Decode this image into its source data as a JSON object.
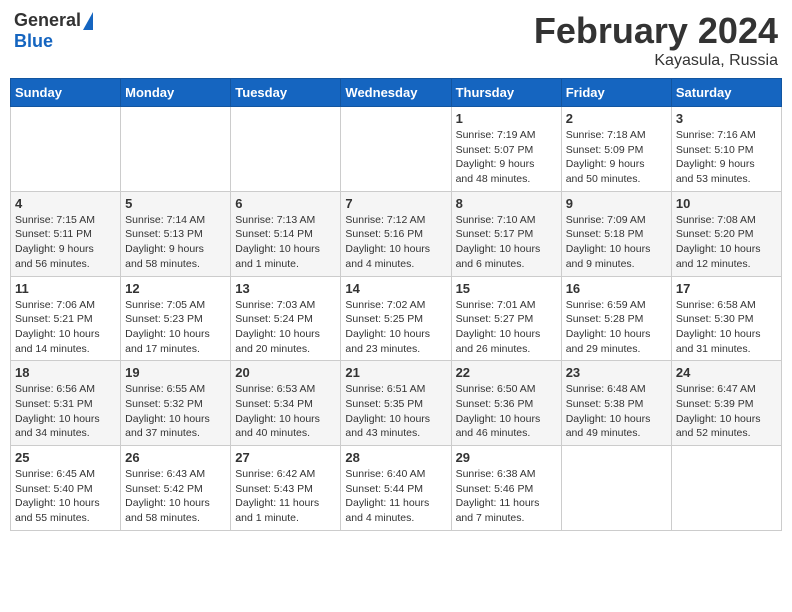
{
  "header": {
    "logo_general": "General",
    "logo_blue": "Blue",
    "month_title": "February 2024",
    "location": "Kayasula, Russia"
  },
  "days_of_week": [
    "Sunday",
    "Monday",
    "Tuesday",
    "Wednesday",
    "Thursday",
    "Friday",
    "Saturday"
  ],
  "weeks": [
    [
      {
        "day": "",
        "info": ""
      },
      {
        "day": "",
        "info": ""
      },
      {
        "day": "",
        "info": ""
      },
      {
        "day": "",
        "info": ""
      },
      {
        "day": "1",
        "info": "Sunrise: 7:19 AM\nSunset: 5:07 PM\nDaylight: 9 hours\nand 48 minutes."
      },
      {
        "day": "2",
        "info": "Sunrise: 7:18 AM\nSunset: 5:09 PM\nDaylight: 9 hours\nand 50 minutes."
      },
      {
        "day": "3",
        "info": "Sunrise: 7:16 AM\nSunset: 5:10 PM\nDaylight: 9 hours\nand 53 minutes."
      }
    ],
    [
      {
        "day": "4",
        "info": "Sunrise: 7:15 AM\nSunset: 5:11 PM\nDaylight: 9 hours\nand 56 minutes."
      },
      {
        "day": "5",
        "info": "Sunrise: 7:14 AM\nSunset: 5:13 PM\nDaylight: 9 hours\nand 58 minutes."
      },
      {
        "day": "6",
        "info": "Sunrise: 7:13 AM\nSunset: 5:14 PM\nDaylight: 10 hours\nand 1 minute."
      },
      {
        "day": "7",
        "info": "Sunrise: 7:12 AM\nSunset: 5:16 PM\nDaylight: 10 hours\nand 4 minutes."
      },
      {
        "day": "8",
        "info": "Sunrise: 7:10 AM\nSunset: 5:17 PM\nDaylight: 10 hours\nand 6 minutes."
      },
      {
        "day": "9",
        "info": "Sunrise: 7:09 AM\nSunset: 5:18 PM\nDaylight: 10 hours\nand 9 minutes."
      },
      {
        "day": "10",
        "info": "Sunrise: 7:08 AM\nSunset: 5:20 PM\nDaylight: 10 hours\nand 12 minutes."
      }
    ],
    [
      {
        "day": "11",
        "info": "Sunrise: 7:06 AM\nSunset: 5:21 PM\nDaylight: 10 hours\nand 14 minutes."
      },
      {
        "day": "12",
        "info": "Sunrise: 7:05 AM\nSunset: 5:23 PM\nDaylight: 10 hours\nand 17 minutes."
      },
      {
        "day": "13",
        "info": "Sunrise: 7:03 AM\nSunset: 5:24 PM\nDaylight: 10 hours\nand 20 minutes."
      },
      {
        "day": "14",
        "info": "Sunrise: 7:02 AM\nSunset: 5:25 PM\nDaylight: 10 hours\nand 23 minutes."
      },
      {
        "day": "15",
        "info": "Sunrise: 7:01 AM\nSunset: 5:27 PM\nDaylight: 10 hours\nand 26 minutes."
      },
      {
        "day": "16",
        "info": "Sunrise: 6:59 AM\nSunset: 5:28 PM\nDaylight: 10 hours\nand 29 minutes."
      },
      {
        "day": "17",
        "info": "Sunrise: 6:58 AM\nSunset: 5:30 PM\nDaylight: 10 hours\nand 31 minutes."
      }
    ],
    [
      {
        "day": "18",
        "info": "Sunrise: 6:56 AM\nSunset: 5:31 PM\nDaylight: 10 hours\nand 34 minutes."
      },
      {
        "day": "19",
        "info": "Sunrise: 6:55 AM\nSunset: 5:32 PM\nDaylight: 10 hours\nand 37 minutes."
      },
      {
        "day": "20",
        "info": "Sunrise: 6:53 AM\nSunset: 5:34 PM\nDaylight: 10 hours\nand 40 minutes."
      },
      {
        "day": "21",
        "info": "Sunrise: 6:51 AM\nSunset: 5:35 PM\nDaylight: 10 hours\nand 43 minutes."
      },
      {
        "day": "22",
        "info": "Sunrise: 6:50 AM\nSunset: 5:36 PM\nDaylight: 10 hours\nand 46 minutes."
      },
      {
        "day": "23",
        "info": "Sunrise: 6:48 AM\nSunset: 5:38 PM\nDaylight: 10 hours\nand 49 minutes."
      },
      {
        "day": "24",
        "info": "Sunrise: 6:47 AM\nSunset: 5:39 PM\nDaylight: 10 hours\nand 52 minutes."
      }
    ],
    [
      {
        "day": "25",
        "info": "Sunrise: 6:45 AM\nSunset: 5:40 PM\nDaylight: 10 hours\nand 55 minutes."
      },
      {
        "day": "26",
        "info": "Sunrise: 6:43 AM\nSunset: 5:42 PM\nDaylight: 10 hours\nand 58 minutes."
      },
      {
        "day": "27",
        "info": "Sunrise: 6:42 AM\nSunset: 5:43 PM\nDaylight: 11 hours\nand 1 minute."
      },
      {
        "day": "28",
        "info": "Sunrise: 6:40 AM\nSunset: 5:44 PM\nDaylight: 11 hours\nand 4 minutes."
      },
      {
        "day": "29",
        "info": "Sunrise: 6:38 AM\nSunset: 5:46 PM\nDaylight: 11 hours\nand 7 minutes."
      },
      {
        "day": "",
        "info": ""
      },
      {
        "day": "",
        "info": ""
      }
    ]
  ]
}
